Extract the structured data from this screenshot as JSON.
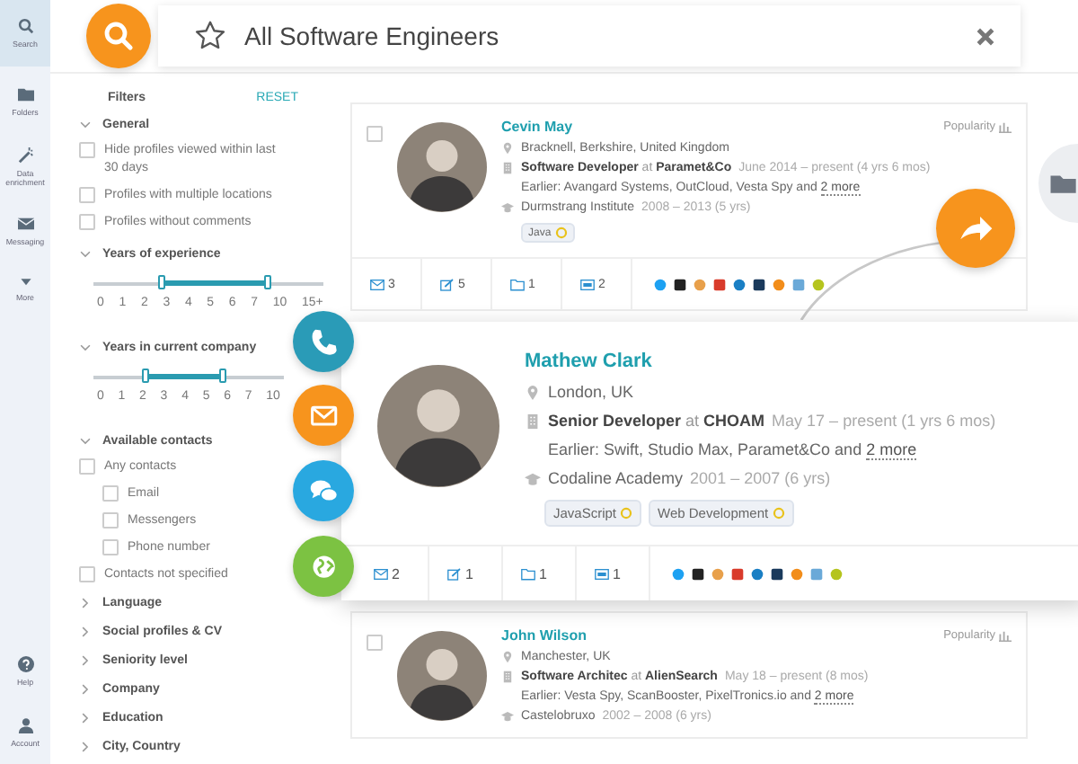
{
  "nav": {
    "top": [
      {
        "kind": "search",
        "label": "Search",
        "selected": true
      },
      {
        "kind": "folder",
        "label": "Folders",
        "selected": false
      },
      {
        "kind": "wand",
        "label": "Data enrichment",
        "selected": false
      },
      {
        "kind": "mail",
        "label": "Messaging",
        "selected": false
      },
      {
        "kind": "caret",
        "label": "More",
        "selected": false
      }
    ],
    "bottom": [
      {
        "kind": "help",
        "label": "Help",
        "selected": false
      },
      {
        "kind": "user",
        "label": "Account",
        "selected": false
      }
    ]
  },
  "search": {
    "value": "All Software Engineers"
  },
  "filters": {
    "title": "Filters",
    "reset": "RESET",
    "groups": [
      {
        "kind": "checks",
        "label": "General",
        "expanded": true,
        "options": [
          {
            "label": "Hide profiles viewed within last 30 days",
            "checked": false
          },
          {
            "label": "Profiles with multiple locations",
            "checked": false
          },
          {
            "label": "Profiles without comments",
            "checked": false
          }
        ]
      },
      {
        "kind": "range",
        "label": "Years of experience",
        "expanded": true,
        "thumbs": [
          {
            "level": 0.3
          },
          {
            "level": 0.76
          }
        ],
        "ticks": [
          "0",
          "1",
          "2",
          "3",
          "4",
          "5",
          "6",
          "7",
          "10",
          "15+"
        ]
      },
      {
        "kind": "range",
        "label": "Years in current company",
        "expanded": true,
        "thumbs": [
          {
            "level": 0.27
          },
          {
            "level": 0.68
          }
        ],
        "ticks": [
          "0",
          "1",
          "2",
          "3",
          "4",
          "5",
          "6",
          "7",
          "10"
        ]
      },
      {
        "kind": "checks",
        "label": "Available contacts",
        "expanded": true,
        "options": [
          {
            "label": "Any contacts",
            "checked": false,
            "children": [
              {
                "label": "Email",
                "checked": false
              },
              {
                "label": "Messengers",
                "checked": false
              },
              {
                "label": "Phone number",
                "checked": false
              }
            ]
          },
          {
            "label": "Contacts not specified",
            "checked": false
          }
        ]
      },
      {
        "kind": "plain",
        "label": "Language",
        "expanded": false
      },
      {
        "kind": "plain",
        "label": "Social profiles & CV",
        "expanded": false
      },
      {
        "kind": "plain",
        "label": "Seniority level",
        "expanded": false
      },
      {
        "kind": "plain",
        "label": "Company",
        "expanded": false
      },
      {
        "kind": "plain",
        "label": "Education",
        "expanded": false
      },
      {
        "kind": "plain",
        "label": "City, Country",
        "expanded": false
      }
    ]
  },
  "profiles": [
    {
      "kind": "card",
      "checked": false,
      "name": "Cevin May",
      "popularity": "Popularity",
      "location": "Bracknell, Berkshire, United Kingdom",
      "role": "**Software Developer** at **Paramet&Co**",
      "period": "June 2014 – present (4 yrs 6 mos)",
      "earlier": "Earlier: Avangard Systems, OutCloud, Vesta Spy and",
      "more": "2 more",
      "school": "Durmstrang Institute",
      "school_years": "2008 – 2013 (5 yrs)",
      "tags": [
        "Java"
      ],
      "counts": [
        {
          "kind": "mail",
          "count": "3"
        },
        {
          "kind": "note",
          "count": "5"
        },
        {
          "kind": "folder",
          "count": "1"
        },
        {
          "kind": "card",
          "count": "2"
        }
      ]
    },
    {
      "kind": "highlighted",
      "name": "Mathew Clark",
      "location": "London, UK",
      "role": "**Senior Developer** at **CHOAM**",
      "period": "May 17 – present (1 yrs 6 mos)",
      "earlier": "Earlier: Swift, Studio Max, Paramet&Co and",
      "more": "2 more",
      "school": "Codaline Academy",
      "school_years": "2001 – 2007 (6 yrs)",
      "tags": [
        "JavaScript",
        "Web Development"
      ],
      "counts": [
        {
          "kind": "mail",
          "count": "2"
        },
        {
          "kind": "note",
          "count": "1"
        },
        {
          "kind": "folder",
          "count": "1"
        },
        {
          "kind": "card",
          "count": "1"
        }
      ]
    },
    {
      "kind": "card",
      "checked": false,
      "name": "John Wilson",
      "popularity": "Popularity",
      "location": "Manchester, UK",
      "role": "**Software Architec** at **AlienSearch**",
      "period": "May 18 – present (8 mos)",
      "earlier": "Earlier: Vesta Spy, ScanBooster, PixelTronics.io and",
      "more": "2 more",
      "school": "Castelobruxo",
      "school_years": "2002 – 2008 (6 yrs)"
    }
  ]
}
